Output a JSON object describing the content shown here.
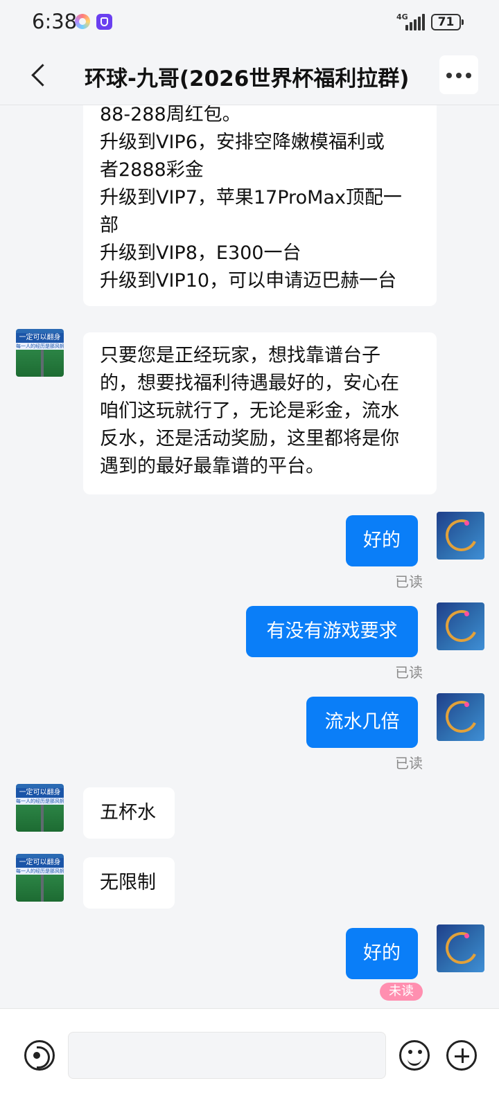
{
  "status_bar": {
    "time": "6:38",
    "network": "4G",
    "battery": "71",
    "icons": [
      "colorful-ring-app-icon",
      "shield-app-icon",
      "signal-icon",
      "battery-icon"
    ]
  },
  "header": {
    "title": "环球-九哥(2026世界杯福利拉群)",
    "back_icon": "chevron-left-icon",
    "more_icon": "more-dots-icon"
  },
  "messages": [
    {
      "from": "peer",
      "lines": [
        "88-288周红包。",
        "升级到VIP6，安排空降嫩模福利或",
        "者2888彩金",
        "升级到VIP7，苹果17ProMax顶配一",
        "部",
        "升级到VIP8，E300一台",
        "升级到VIP10，可以申请迈巴赫一台"
      ]
    },
    {
      "from": "peer",
      "lines": [
        "只要您是正经玩家，想找靠谱台子",
        "的，想要找福利待遇最好的，安心在",
        "咱们这玩就行了，无论是彩金，流水",
        "反水，还是活动奖励，这里都将是你",
        "遇到的最好最靠谱的平台。"
      ]
    },
    {
      "from": "me",
      "text": "好的",
      "status": "已读"
    },
    {
      "from": "me",
      "text": "有没有游戏要求",
      "status": "已读"
    },
    {
      "from": "me",
      "text": "流水几倍",
      "status": "已读"
    },
    {
      "from": "peer",
      "text": "五杯水"
    },
    {
      "from": "peer",
      "text": "无限制"
    },
    {
      "from": "me",
      "text": "好的",
      "status": "未读"
    }
  ],
  "peer_avatar": {
    "banner_text": "一定可以翻身",
    "sub_text": "每一人的经历是那风帆"
  },
  "input_bar": {
    "placeholder": "",
    "voice_icon": "voice-icon",
    "emoji_icon": "emoji-icon",
    "plus_icon": "plus-icon"
  },
  "colors": {
    "accent": "#0a7ef8",
    "background": "#f4f5f7",
    "unread_badge": "#ff8fb0"
  }
}
